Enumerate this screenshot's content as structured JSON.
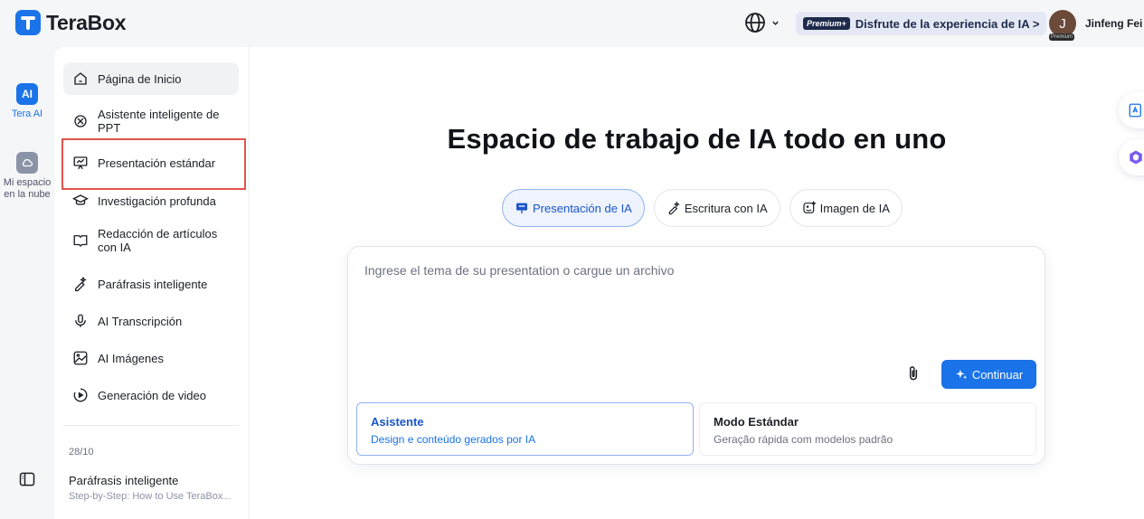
{
  "header": {
    "brand": "TeraBox",
    "promo_badge": "Premium+",
    "promo_text": "Disfrute de la experiencia de IA >",
    "user_initial": "J",
    "user_badge": "Premium",
    "user_name": "Jinfeng Fei"
  },
  "rail": {
    "items": [
      {
        "label": "Tera AI",
        "icon": "ai-icon",
        "active": true
      },
      {
        "label": "Mi espacio en la nube",
        "icon": "cloud-icon",
        "active": false
      }
    ],
    "ai_icon_text": "AI"
  },
  "sidebar": {
    "items": [
      {
        "label": "Página de Inicio",
        "icon": "home-icon"
      },
      {
        "label": "Asistente inteligente de PPT",
        "icon": "ppt-assistant-icon"
      },
      {
        "label": "Presentación estándar",
        "icon": "presentation-icon"
      },
      {
        "label": "Investigación profunda",
        "icon": "research-icon"
      },
      {
        "label": "Redacción de artículos con IA",
        "icon": "article-icon"
      },
      {
        "label": "Paráfrasis inteligente",
        "icon": "paraphrase-icon"
      },
      {
        "label": "AI Transcripción",
        "icon": "microphone-icon"
      },
      {
        "label": "AI Imágenes",
        "icon": "image-icon"
      },
      {
        "label": "Generación de video",
        "icon": "video-icon"
      }
    ],
    "recent": {
      "date": "28/10",
      "title": "Paráfrasis inteligente",
      "subtitle": "Step-by-Step: How to Use TeraBox..."
    }
  },
  "main": {
    "title": "Espacio de trabajo de IA todo en uno",
    "tabs": [
      {
        "label": "Presentación de IA",
        "active": true
      },
      {
        "label": "Escritura con IA",
        "active": false
      },
      {
        "label": "Imagen de IA",
        "active": false
      }
    ],
    "prompt": {
      "placeholder": "Ingrese el tema de su presentation o cargue un archivo",
      "value": "",
      "continue_label": "Continuar"
    },
    "modes": [
      {
        "title": "Asistente",
        "subtitle": "Design e conteúdo gerados por IA",
        "selected": true
      },
      {
        "title": "Modo Estándar",
        "subtitle": "Geração rápida com modelos padrão",
        "selected": false
      }
    ]
  },
  "colors": {
    "accent": "#1a73e8",
    "highlight": "#e2554d"
  }
}
